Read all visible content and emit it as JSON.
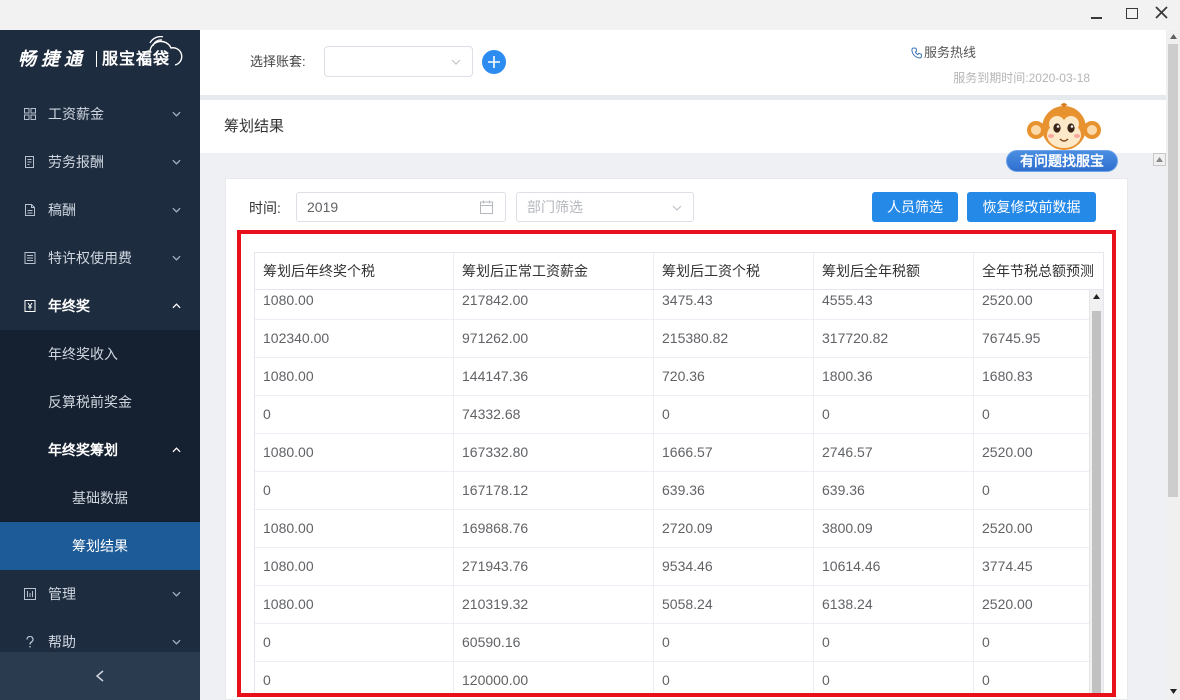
{
  "window_controls": {
    "icons": [
      "minimize-icon",
      "maximize-icon",
      "close-icon"
    ]
  },
  "logo": {
    "brand": "畅捷通",
    "product": "服宝福袋"
  },
  "sidebar": {
    "items": [
      {
        "label": "工资薪金",
        "icon": "grid-icon",
        "expanded": false
      },
      {
        "label": "劳务报酬",
        "icon": "receipt-icon",
        "expanded": false
      },
      {
        "label": "稿酬",
        "icon": "document-icon",
        "expanded": false
      },
      {
        "label": "特许权使用费",
        "icon": "list-document-icon",
        "expanded": false
      },
      {
        "label": "年终奖",
        "icon": "bonus-icon",
        "expanded": true
      },
      {
        "label": "年终奖收入"
      },
      {
        "label": "反算税前奖金"
      },
      {
        "label": "年终奖筹划",
        "expanded": true
      },
      {
        "label": "基础数据"
      },
      {
        "label": "筹划结果",
        "active": true
      },
      {
        "label": "管理",
        "icon": "management-icon",
        "expanded": false
      },
      {
        "label": "帮助",
        "icon": "help-icon",
        "expanded": false
      }
    ],
    "collapse_icon": "chevron-left-icon"
  },
  "header": {
    "account_label": "选择账套:",
    "account_value": "",
    "add_account_icon": "plus-icon",
    "hotline_icon": "phone-icon",
    "hotline_label": "服务热线",
    "expiry_text": "服务到期时间:2020-03-18"
  },
  "page": {
    "title": "筹划结果",
    "mascot_icon": "monkey-mascot-icon",
    "help_badge": "有问题找服宝"
  },
  "filters": {
    "time_label": "时间:",
    "time_value": "2019",
    "department_placeholder": "部门筛选",
    "staff_filter_button": "人员筛选",
    "restore_button": "恢复修改前数据"
  },
  "table": {
    "columns": [
      "筹划后年终奖个税",
      "筹划后正常工资薪金",
      "筹划后工资个税",
      "筹划后全年税额",
      "全年节税总额预测"
    ],
    "rows": [
      [
        "1080.00",
        "217842.00",
        "3475.43",
        "4555.43",
        "2520.00"
      ],
      [
        "102340.00",
        "971262.00",
        "215380.82",
        "317720.82",
        "76745.95"
      ],
      [
        "1080.00",
        "144147.36",
        "720.36",
        "1800.36",
        "1680.83"
      ],
      [
        "0",
        "74332.68",
        "0",
        "0",
        "0"
      ],
      [
        "1080.00",
        "167332.80",
        "1666.57",
        "2746.57",
        "2520.00"
      ],
      [
        "0",
        "167178.12",
        "639.36",
        "639.36",
        "0"
      ],
      [
        "1080.00",
        "169868.76",
        "2720.09",
        "3800.09",
        "2520.00"
      ],
      [
        "1080.00",
        "271943.76",
        "9534.46",
        "10614.46",
        "3774.45"
      ],
      [
        "1080.00",
        "210319.32",
        "5058.24",
        "6138.24",
        "2520.00"
      ],
      [
        "0",
        "60590.16",
        "0",
        "0",
        "0"
      ],
      [
        "0",
        "120000.00",
        "0",
        "0",
        "0"
      ]
    ]
  },
  "colors": {
    "accent": "#2589e8",
    "sidebar_bg": "#1e2c3f",
    "sidebar_active": "#1c5a98",
    "highlight_border": "#e8101a"
  }
}
